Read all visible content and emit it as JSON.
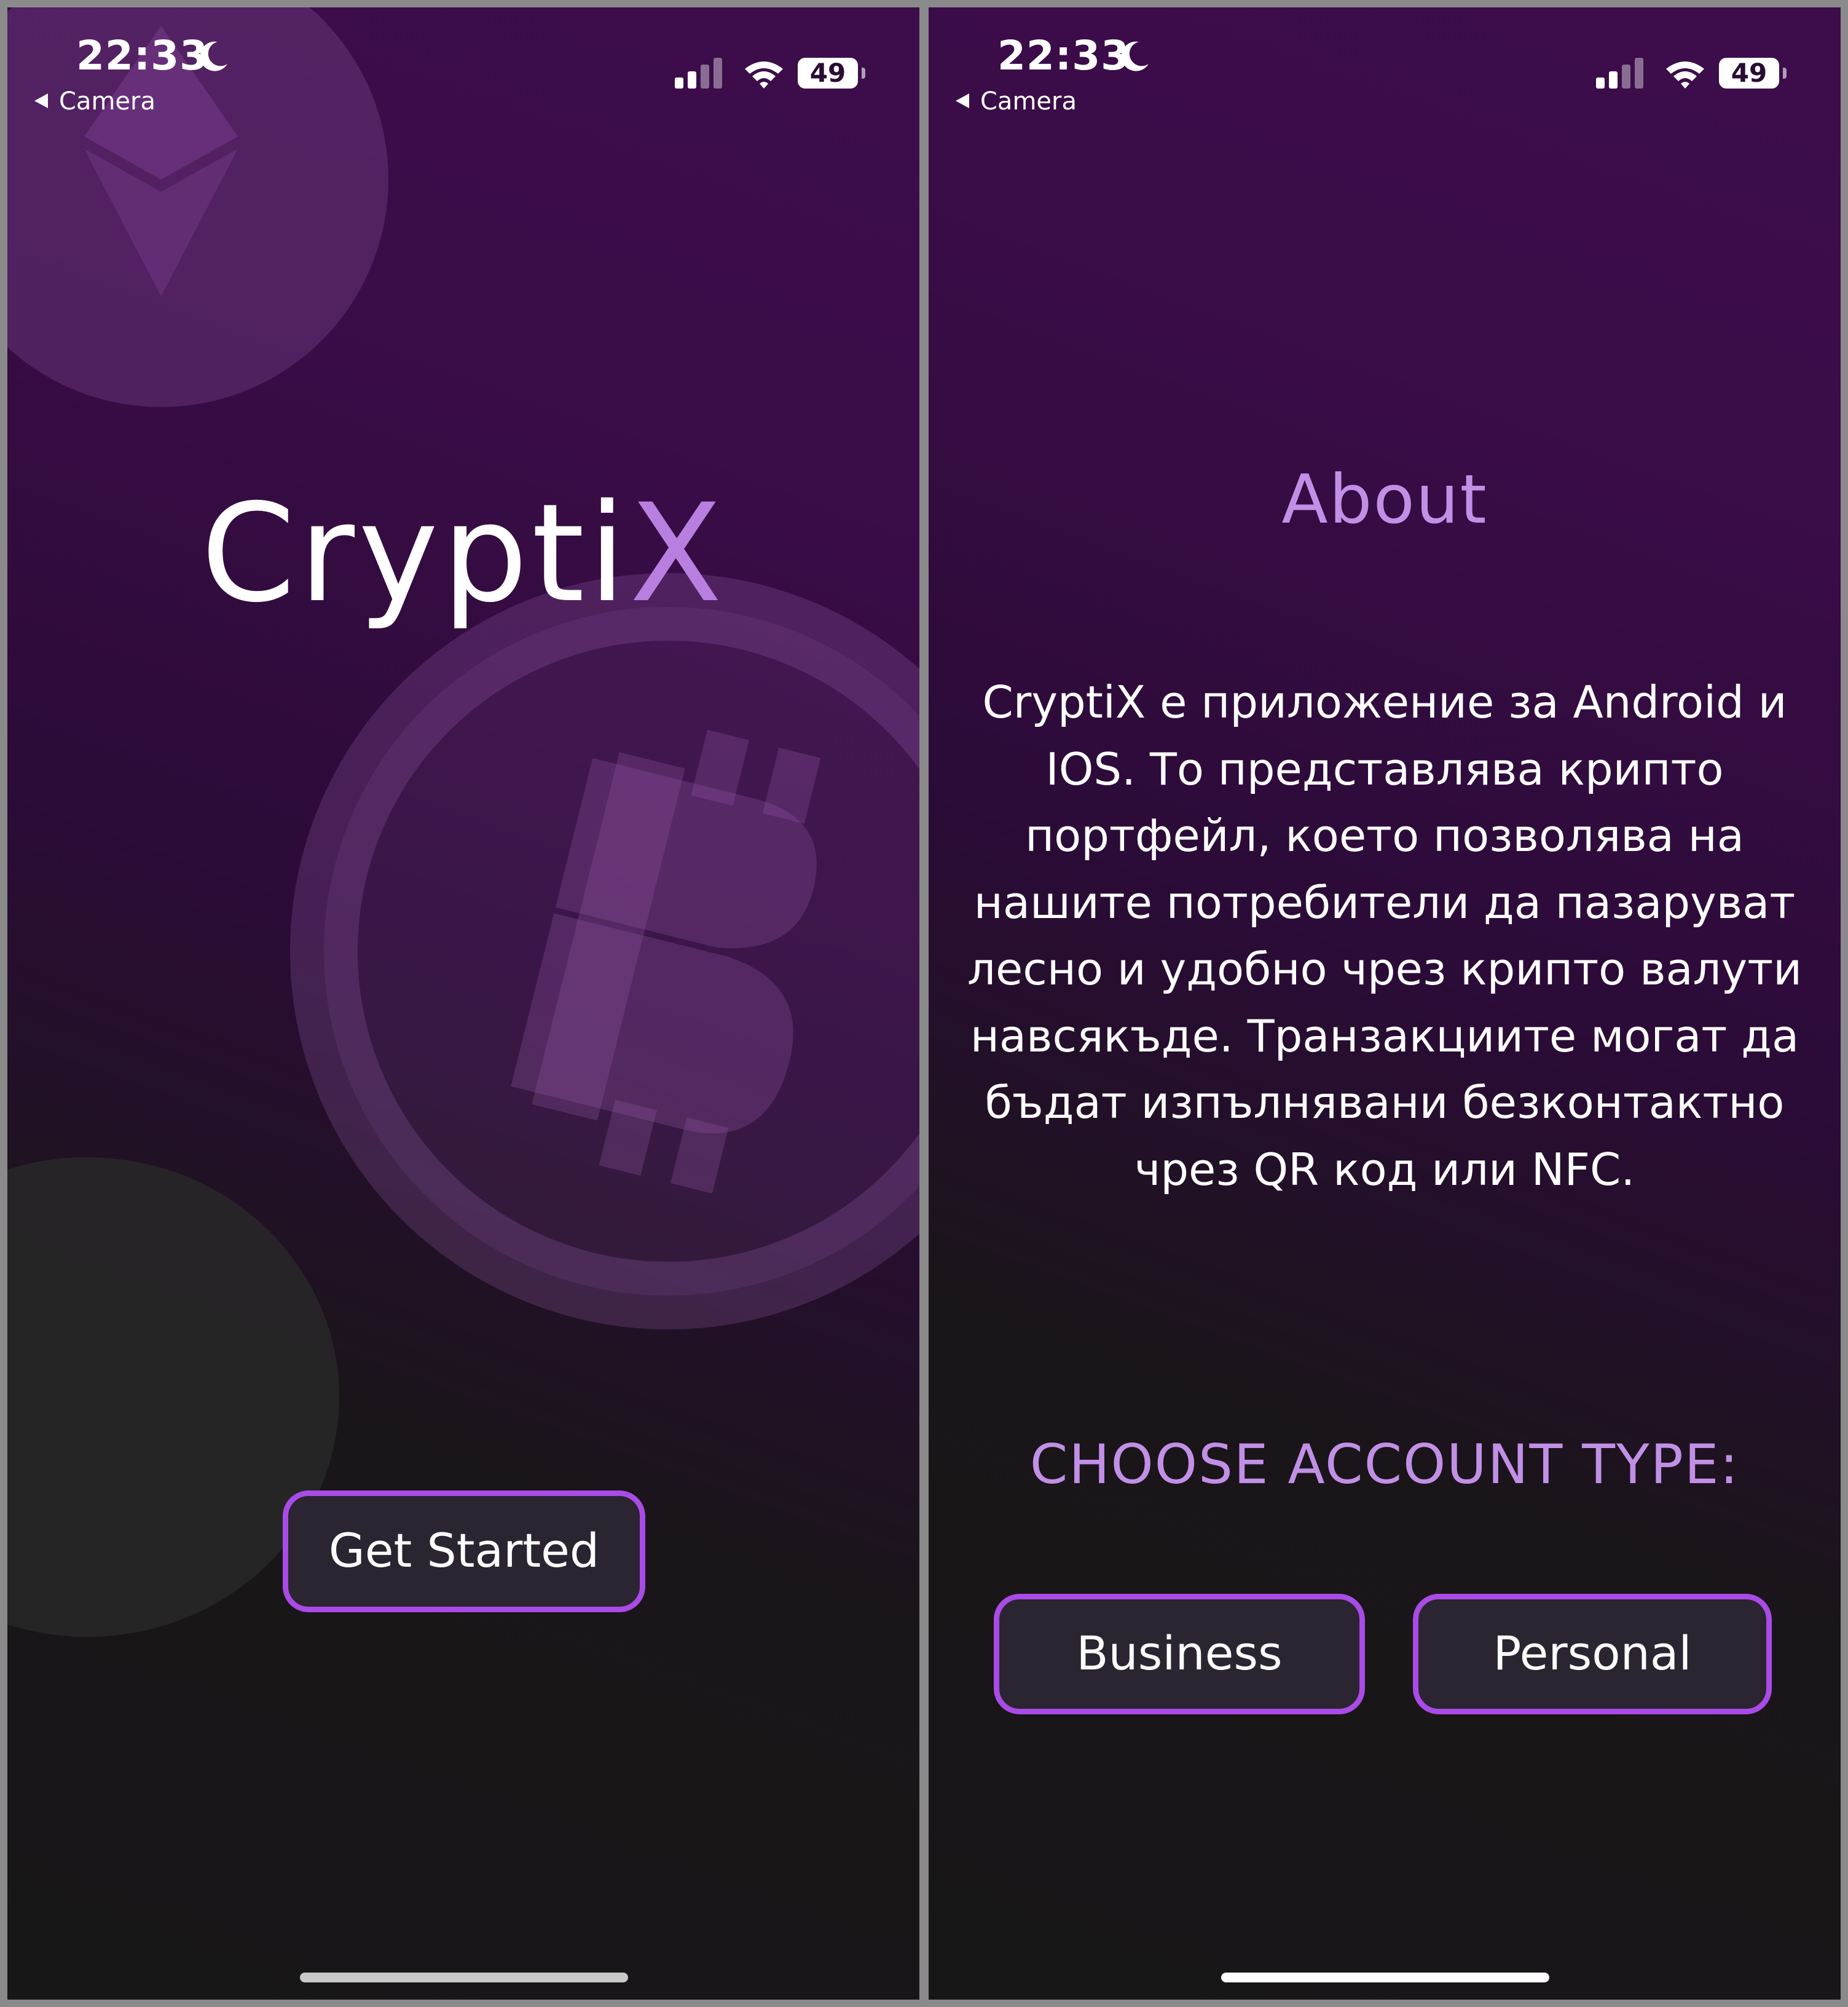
{
  "status_bar": {
    "time": "22:33",
    "back_label": "Camera",
    "battery": "49"
  },
  "welcome": {
    "logo_main": "Crypti",
    "logo_accent": "X",
    "get_started_label": "Get Started"
  },
  "about": {
    "title": "About",
    "body": "CryptiX е приложение за Android и IOS. То представлява крипто портфейл, което позволява на нашите потребители да пазаруват лесно и удобно чрез крипто валути навсякъде. Транзакциите могат да бъдат изпълнявани безконтактно чрез QR код или NFC.",
    "account_type_label": "CHOOSE ACCOUNT TYPE:",
    "business_label": "Business",
    "personal_label": "Personal"
  },
  "colors": {
    "accent": "#b87fe0",
    "button_border": "#a94be6",
    "background_top": "#3c0d4a",
    "background_bottom": "#171717"
  },
  "icons": [
    "moon-icon",
    "signal-icon",
    "wifi-icon",
    "battery-icon",
    "ethereum-icon",
    "bitcoin-icon",
    "back-arrow-icon"
  ]
}
